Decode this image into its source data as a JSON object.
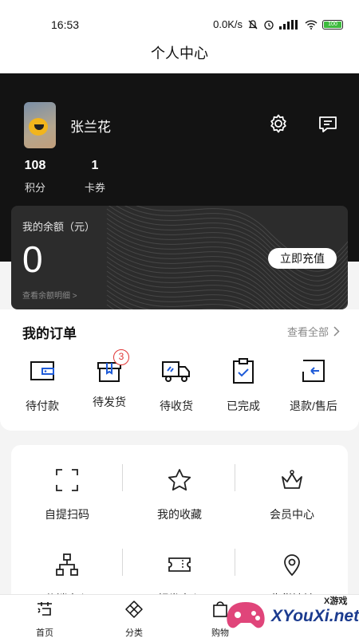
{
  "status": {
    "time": "16:53",
    "speed": "0.0K/s",
    "battery": "100"
  },
  "page": {
    "title": "个人中心"
  },
  "user": {
    "name": "张兰花"
  },
  "stats": [
    {
      "value": "108",
      "label": "积分"
    },
    {
      "value": "1",
      "label": "卡券"
    }
  ],
  "balance": {
    "label": "我的余额（元）",
    "value": "0",
    "detail": "查看余额明细 >",
    "recharge_label": "立即充值"
  },
  "orders": {
    "title": "我的订单",
    "view_all": "查看全部",
    "items": [
      {
        "label": "待付款",
        "icon": "wallet-icon"
      },
      {
        "label": "待发货",
        "icon": "package-icon",
        "badge": "3"
      },
      {
        "label": "待收货",
        "icon": "truck-icon"
      },
      {
        "label": "已完成",
        "icon": "clipboard-check-icon"
      },
      {
        "label": "退款/售后",
        "icon": "refund-icon"
      }
    ]
  },
  "services": [
    {
      "label": "自提扫码",
      "icon": "scan-icon"
    },
    {
      "label": "我的收藏",
      "icon": "star-icon"
    },
    {
      "label": "会员中心",
      "icon": "crown-icon"
    },
    {
      "label": "分销中心",
      "icon": "org-chart-icon"
    },
    {
      "label": "领券中心",
      "icon": "ticket-icon"
    },
    {
      "label": "收货地址",
      "icon": "location-pin-icon"
    }
  ],
  "tabs": [
    {
      "label": "首页",
      "icon": "home-logo-icon"
    },
    {
      "label": "分类",
      "icon": "category-icon"
    },
    {
      "label": "购物",
      "icon": "cart-icon"
    }
  ],
  "watermark": {
    "brand": "XYouXi.net",
    "small": "X游戏"
  },
  "colors": {
    "hero_bg": "#131313",
    "badge": "#e03434",
    "order_accent": "#1e5bd8"
  }
}
